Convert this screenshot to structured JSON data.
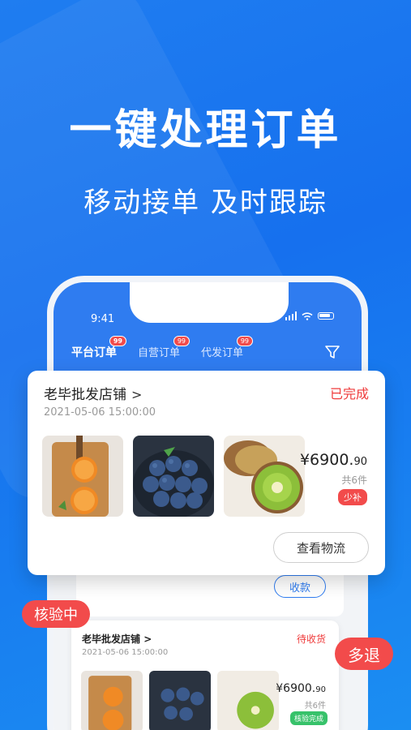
{
  "promo": {
    "headline": "一键处理订单",
    "subline": "移动接单 及时跟踪"
  },
  "phone": {
    "status_time": "9:41",
    "tabs": [
      {
        "label": "平台订单",
        "count": "99",
        "active": true
      },
      {
        "label": "自营订单",
        "count": "99",
        "active": false
      },
      {
        "label": "代发订单",
        "count": "99",
        "active": false
      }
    ],
    "filter_icon": "filter-icon",
    "receive_label": "收款"
  },
  "order_card": {
    "shop_name": "老毕批发店铺",
    "status": "已完成",
    "datetime": "2021-05-06 15:00:00",
    "products": [
      "orange",
      "blueberry",
      "kiwi"
    ],
    "price_main": "¥6900.",
    "price_decimal": "90",
    "quantity": "共6件",
    "tag": "少补",
    "logistics_label": "查看物流"
  },
  "order_card_2": {
    "shop_name": "老毕批发店铺",
    "status": "待收货",
    "datetime": "2021-05-06 15:00:00",
    "price_main": "¥6900.",
    "price_decimal": "90",
    "quantity": "共6件",
    "tag": "核验完成"
  },
  "badges": {
    "verifying": "核验中",
    "refund": "多退"
  },
  "colors": {
    "brand_blue": "#2f7cf0",
    "alert_red": "#f24b4b",
    "success_green": "#37c26a"
  }
}
